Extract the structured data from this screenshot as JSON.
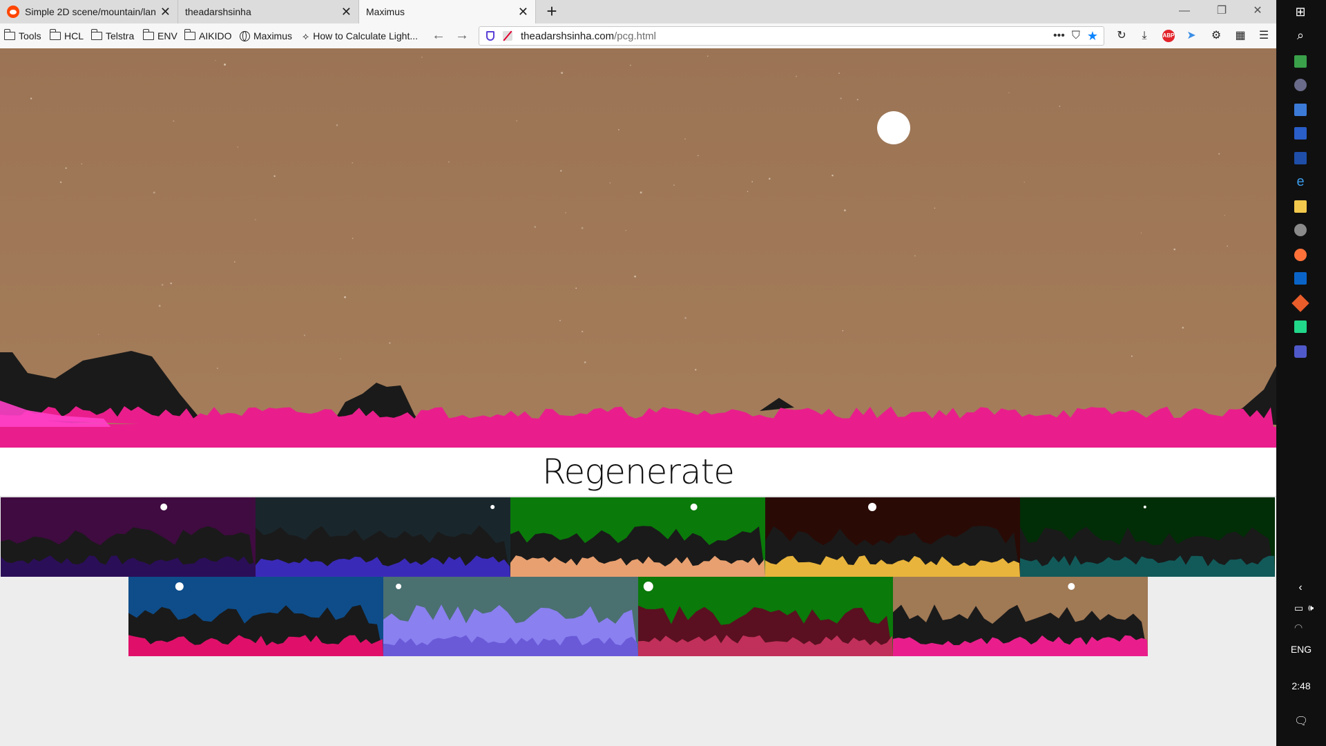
{
  "browser": {
    "tabs": [
      {
        "title": "Simple 2D scene/mountain/lan",
        "active": false
      },
      {
        "title": "theadarshsinha",
        "active": false
      },
      {
        "title": "Maximus",
        "active": true
      }
    ],
    "new_tab_label": "+",
    "bookmarks": [
      {
        "label": "Tools",
        "icon": "folder-icon"
      },
      {
        "label": "HCL",
        "icon": "folder-icon"
      },
      {
        "label": "Telstra",
        "icon": "folder-icon"
      },
      {
        "label": "ENV",
        "icon": "folder-icon"
      },
      {
        "label": "AIKIDO",
        "icon": "folder-icon"
      },
      {
        "label": "Maximus",
        "icon": "globe-icon"
      },
      {
        "label": "How to Calculate Light...",
        "icon": "link-icon"
      }
    ],
    "url": {
      "host": "theadarshsinha.com",
      "path": "/pcg.html"
    },
    "page_actions": "•••"
  },
  "page": {
    "regenerate_label": "Regenerate",
    "hero": {
      "sky": "#9b7455",
      "sky_light": "#a57d5a",
      "mountain": "#1a1a1a",
      "ground": "#e91e8c",
      "ground_light": "#ff40c8"
    },
    "thumbnails": [
      {
        "sky": "#3f0b40",
        "mid": "#1a1a1a",
        "ground": "#2b0e58",
        "moon_x": 0.64,
        "moon_r": 5
      },
      {
        "sky": "#19272d",
        "mid": "#1a1a1a",
        "ground": "#3a2ab8",
        "moon_x": 0.93,
        "moon_r": 3
      },
      {
        "sky": "#0a7a0a",
        "mid": "#1a1a1a",
        "ground": "#e8a070",
        "moon_x": 0.72,
        "moon_r": 5
      },
      {
        "sky": "#2a0a05",
        "mid": "#1a1a1a",
        "ground": "#e8b43c",
        "moon_x": 0.42,
        "moon_r": 6
      },
      {
        "sky": "#012e06",
        "mid": "#1a1a1a",
        "ground": "#125a5a",
        "moon_x": 0.49,
        "moon_r": 2
      },
      {
        "sky": "#0e4d8a",
        "mid": "#1a1a1a",
        "ground": "#e0106a",
        "moon_x": 0.2,
        "moon_r": 6
      },
      {
        "sky": "#4a7070",
        "mid": "#8a80f0",
        "ground": "#6a5ad8",
        "moon_x": 0.06,
        "moon_r": 4
      },
      {
        "sky": "#0a7a0a",
        "mid": "#5a1020",
        "ground": "#c0305a",
        "moon_x": 0.04,
        "moon_r": 7
      },
      {
        "sky": "#a07955",
        "mid": "#1a1a1a",
        "ground": "#e91e8c",
        "moon_x": 0.7,
        "moon_r": 5
      }
    ]
  },
  "taskbar": {
    "language": "ENG",
    "time": "2:48"
  }
}
